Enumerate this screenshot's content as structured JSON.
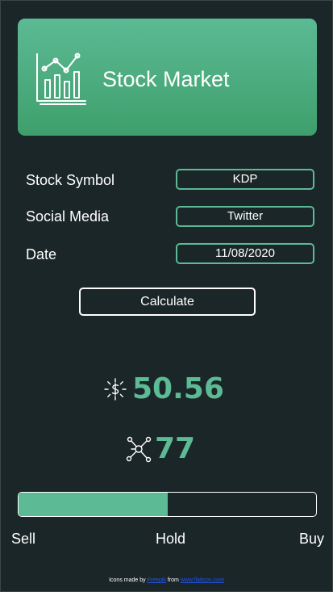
{
  "header": {
    "title": "Stock Market",
    "icon": "chart-presentation-icon"
  },
  "form": {
    "symbol_label": "Stock Symbol",
    "symbol_value": "KDP",
    "social_label": "Social Media",
    "social_value": "Twitter",
    "date_label": "Date",
    "date_value": "11/08/2020",
    "calculate_label": "Calculate"
  },
  "results": {
    "price_value": "50.56",
    "price_icon": "dollar-burst-icon",
    "score_value": "77",
    "score_icon": "network-nodes-icon"
  },
  "sentiment": {
    "level_fraction": 0.5,
    "sell_label": "Sell",
    "hold_label": "Hold",
    "buy_label": "Buy"
  },
  "footer": {
    "prefix": "Icons made by",
    "author": "Freepik",
    "middle": "from",
    "site": "www.flaticon.com"
  },
  "colors": {
    "accent": "#5cba94",
    "background": "#1b2628",
    "banner_top": "#5cba94",
    "banner_bottom": "#3e9f6c"
  }
}
